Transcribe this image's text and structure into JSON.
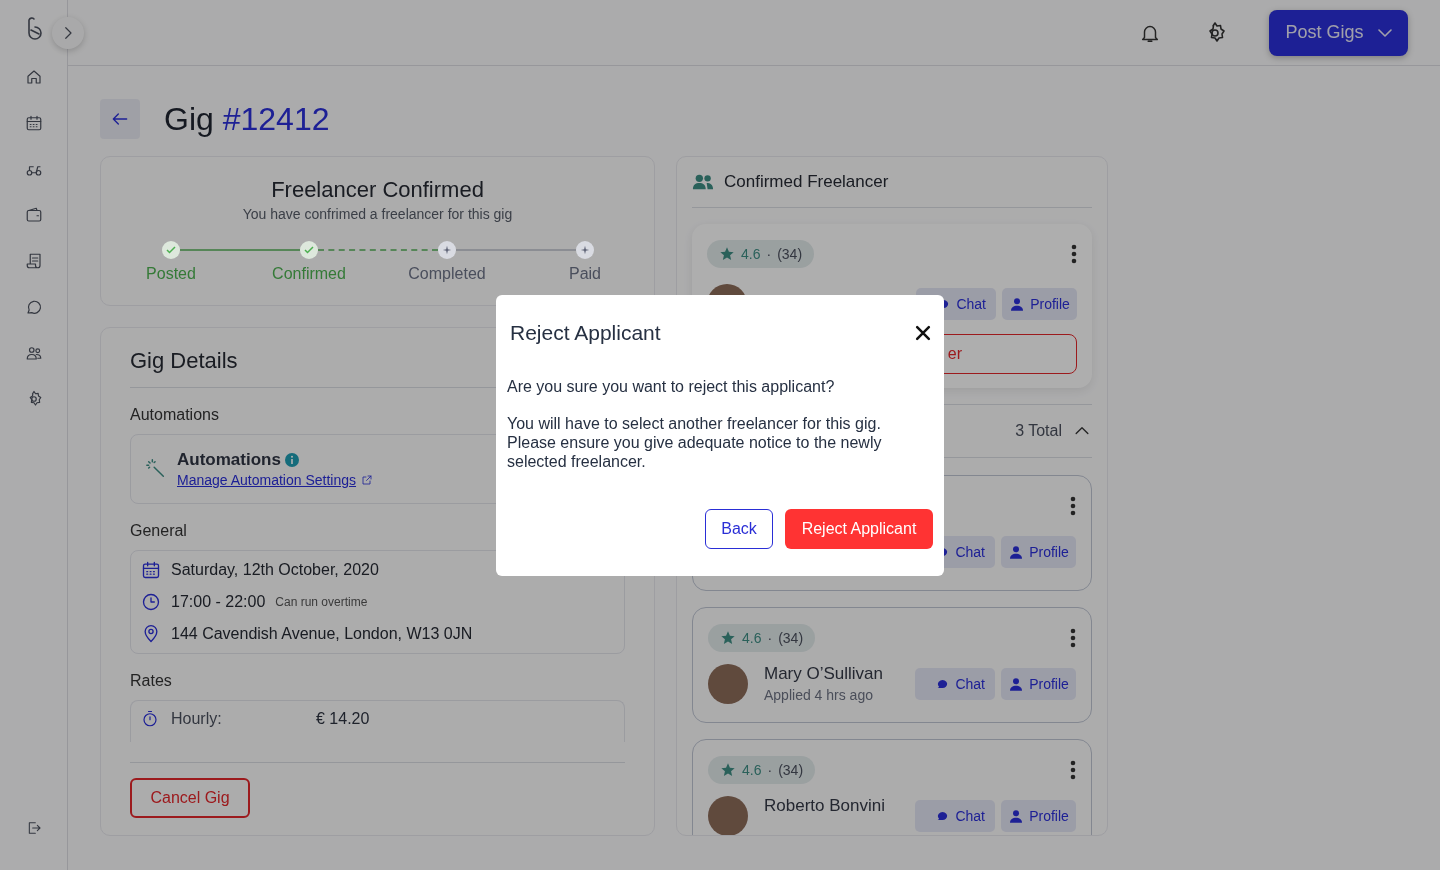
{
  "topbar": {
    "post_button": "Post Gigs"
  },
  "page": {
    "title": "Gig",
    "gig_number": "#12412"
  },
  "status": {
    "title": "Freelancer Confirmed",
    "subtitle": "You have confrimed a freelancer for this gig",
    "steps": [
      {
        "label": "Posted",
        "done": true
      },
      {
        "label": "Confirmed",
        "done": true
      },
      {
        "label": "Completed",
        "done": false
      },
      {
        "label": "Paid",
        "done": false
      }
    ]
  },
  "gig_details": {
    "title": "Gig Details",
    "automations_heading": "Automations",
    "automation_title": "Automations",
    "automation_link": "Manage Automation Settings",
    "general_heading": "General",
    "date": "Saturday, 12th October, 2020",
    "time": "17:00 - 22:00",
    "time_note": "Can run overtime",
    "address": "144 Cavendish Avenue, London, W13 0JN",
    "rates_heading": "Rates",
    "rates": [
      {
        "label": "Hourly:",
        "value": "€ 14.20"
      }
    ],
    "cancel_button": "Cancel Gig"
  },
  "confirmed": {
    "title": "Confirmed Freelancer",
    "rating": "4.6",
    "separator": "·",
    "count": "(34)",
    "chat": "Chat",
    "profile": "Profile",
    "reject_button": "er"
  },
  "applicants": {
    "total": "3 Total",
    "expanded": true,
    "items": [
      {
        "chat": "Chat",
        "profile": "Profile"
      },
      {
        "rating": "4.6",
        "separator": "·",
        "count": "(34)",
        "name": "Mary O’Sullivan",
        "applied": "Applied 4 hrs ago",
        "chat": "Chat",
        "profile": "Profile"
      },
      {
        "rating": "4.6",
        "separator": "·",
        "count": "(34)",
        "name": "Roberto Bonvini",
        "chat": "Chat",
        "profile": "Profile"
      }
    ]
  },
  "modal": {
    "title": "Reject Applicant",
    "paragraphs": [
      "Are you sure you want to reject this applicant?",
      "You will have to select another freelancer for this gig. Please ensure you give adequate notice to the newly selected freelancer."
    ],
    "back_button": "Back",
    "confirm_button": "Reject Applicant"
  }
}
